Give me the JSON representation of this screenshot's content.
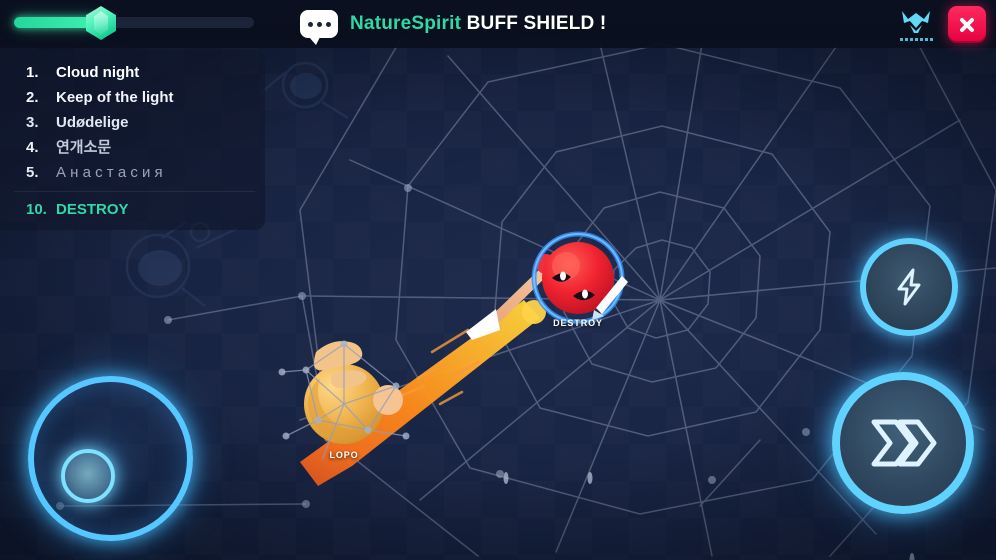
{
  "header": {
    "progress": {
      "fill_percent": 35,
      "gem_icon": "gem-icon"
    },
    "announcement": {
      "bubble_icon": "chat-bubble-icon",
      "player_name": "NatureSpirit",
      "message": "BUFF SHIELD !"
    },
    "brand_emblem_icon": "brand-emblem-icon",
    "close_icon": "close-icon"
  },
  "leaderboard": {
    "entries": [
      {
        "rank": "1.",
        "name": "Cloud night"
      },
      {
        "rank": "2.",
        "name": "Keep of the light"
      },
      {
        "rank": "3.",
        "name": "Udødelige"
      },
      {
        "rank": "4.",
        "name": "연개소문"
      },
      {
        "rank": "5.",
        "name": "А н а с т а с и я"
      }
    ],
    "self": {
      "rank": "10.",
      "name": "DESTROY"
    }
  },
  "entities": {
    "enemy": {
      "label": "DESTROY",
      "color": "#e8243a",
      "shielded": true
    },
    "player": {
      "label": "LOPO",
      "color": "#f0b44a"
    }
  },
  "controls": {
    "joystick": "movement-joystick",
    "boost_button": {
      "icon": "lightning-bolt-icon"
    },
    "attack_button": {
      "icon": "double-chevron-right-icon"
    }
  },
  "colors": {
    "accent_teal": "#2fd9a6",
    "accent_cyan": "#5fd2ff",
    "danger_red": "#ff2a5f",
    "background": "#121c36"
  }
}
